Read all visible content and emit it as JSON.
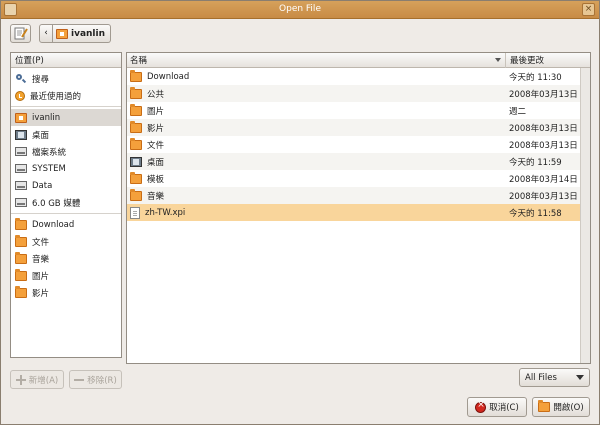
{
  "window": {
    "title": "Open File"
  },
  "pathbar": {
    "crumb": "ivanlin"
  },
  "places": {
    "header": "位置(P)",
    "items": [
      {
        "label": "搜尋",
        "icon": "search-icon",
        "sel": false
      },
      {
        "label": "最近使用過的",
        "icon": "recent-icon",
        "sel": false
      },
      {
        "label": "ivanlin",
        "icon": "home-folder-icon",
        "sel": true
      },
      {
        "label": "桌面",
        "icon": "desktop-icon",
        "sel": false
      },
      {
        "label": "檔案系統",
        "icon": "filesystem-icon",
        "sel": false
      },
      {
        "label": "SYSTEM",
        "icon": "drive-icon",
        "sel": false
      },
      {
        "label": "Data",
        "icon": "drive-icon",
        "sel": false
      },
      {
        "label": "6.0 GB 媒體",
        "icon": "drive-icon",
        "sel": false
      }
    ],
    "bookmarks": [
      {
        "label": "Download",
        "icon": "folder-icon"
      },
      {
        "label": "文件",
        "icon": "folder-icon"
      },
      {
        "label": "音樂",
        "icon": "folder-icon"
      },
      {
        "label": "圖片",
        "icon": "folder-icon"
      },
      {
        "label": "影片",
        "icon": "folder-icon"
      }
    ]
  },
  "files": {
    "col_name": "名稱",
    "col_modified": "最後更改",
    "rows": [
      {
        "name": "Download",
        "modified": "今天的 11:30",
        "icon": "folder-icon"
      },
      {
        "name": "公共",
        "modified": "2008年03月13日",
        "icon": "folder-icon"
      },
      {
        "name": "圖片",
        "modified": "週二",
        "icon": "folder-icon"
      },
      {
        "name": "影片",
        "modified": "2008年03月13日",
        "icon": "folder-icon"
      },
      {
        "name": "文件",
        "modified": "2008年03月13日",
        "icon": "folder-icon"
      },
      {
        "name": "桌面",
        "modified": "今天的 11:59",
        "icon": "desktop-icon"
      },
      {
        "name": "模板",
        "modified": "2008年03月14日",
        "icon": "folder-icon"
      },
      {
        "name": "音樂",
        "modified": "2008年03月13日",
        "icon": "folder-icon"
      },
      {
        "name": "zh-TW.xpi",
        "modified": "今天的 11:58",
        "icon": "document-icon",
        "selected": true
      }
    ]
  },
  "buttons": {
    "add": "新增(A)",
    "remove": "移除(R)",
    "filter": "All Files",
    "cancel": "取消(C)",
    "open": "開啟(O)"
  }
}
